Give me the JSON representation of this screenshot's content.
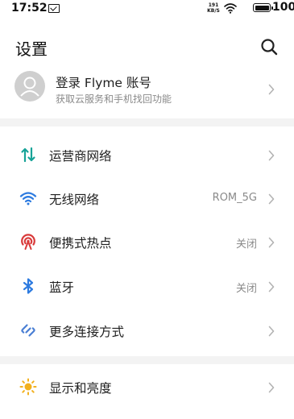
{
  "status_bar": {
    "time": "17:52",
    "speed_value": "191",
    "speed_unit": "KB/S",
    "battery_level": "100"
  },
  "header": {
    "title": "设置"
  },
  "account": {
    "title": "登录 Flyme 账号",
    "subtitle": "获取云服务和手机找回功能"
  },
  "settings": {
    "mobile_network": {
      "label": "运营商网络",
      "icon": "mobile-data-icon",
      "color": "#17a398"
    },
    "wifi": {
      "label": "无线网络",
      "value": "ROM_5G",
      "icon": "wifi-icon",
      "color": "#2d7be0"
    },
    "hotspot": {
      "label": "便携式热点",
      "value": "关闭",
      "icon": "hotspot-icon",
      "color": "#d93a3a"
    },
    "bluetooth": {
      "label": "蓝牙",
      "value": "关闭",
      "icon": "bluetooth-icon",
      "color": "#2d7be0"
    },
    "more_connections": {
      "label": "更多连接方式",
      "icon": "link-icon",
      "color": "#4a7fd4"
    },
    "display": {
      "label": "显示和亮度",
      "icon": "sun-icon",
      "color": "#f2b01e"
    }
  }
}
